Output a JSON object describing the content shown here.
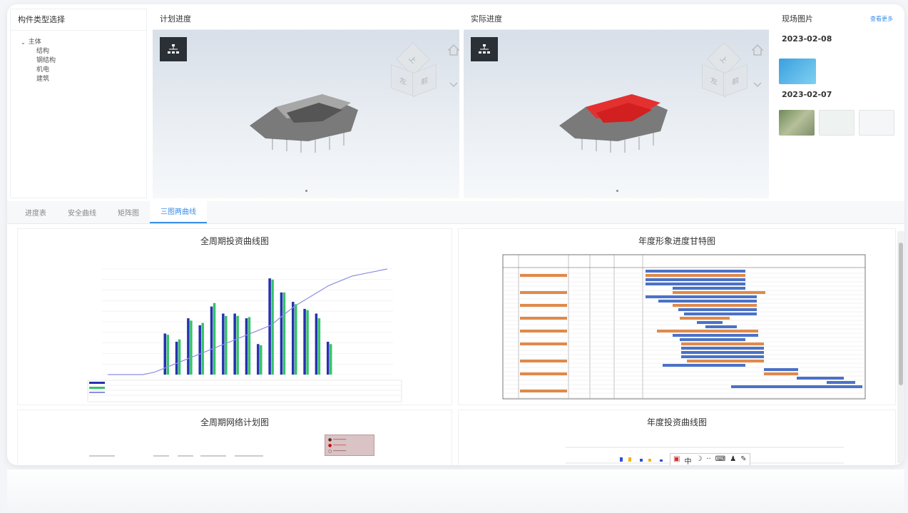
{
  "component_panel": {
    "title": "构件类型选择",
    "tree": {
      "root": "主体",
      "children": [
        "结构",
        "钢结构",
        "机电",
        "建筑"
      ]
    }
  },
  "plan_panel": {
    "title": "计划进度",
    "cube": {
      "top": "上",
      "left": "左",
      "front": "前"
    }
  },
  "actual_panel": {
    "title": "实际进度",
    "cube": {
      "top": "上",
      "left": "左",
      "front": "前"
    }
  },
  "photo_panel": {
    "title": "现场图片",
    "more_link": "查看更多",
    "groups": [
      {
        "date": "2023-02-08"
      },
      {
        "date": "2023-02-07"
      }
    ]
  },
  "tabs": [
    {
      "label": "进度表"
    },
    {
      "label": "安全曲线"
    },
    {
      "label": "矩阵图"
    },
    {
      "label": "三图两曲线",
      "active": true
    }
  ],
  "cards": {
    "investment_curve": {
      "title": "全周期投资曲线图"
    },
    "gantt": {
      "title": "年度形象进度甘特图"
    },
    "network": {
      "title": "全周期网络计划图"
    },
    "annual_investment": {
      "title": "年度投资曲线图"
    }
  },
  "chart_data": {
    "type": "bar",
    "title": "全周期投资曲线图",
    "series": [
      {
        "name": "series-blue",
        "values": [
          0,
          0,
          0,
          0,
          0,
          35,
          28,
          48,
          42,
          58,
          52,
          52,
          48,
          26,
          82,
          70,
          62,
          56,
          52,
          28,
          0,
          0,
          0,
          0,
          0
        ]
      },
      {
        "name": "series-green",
        "values": [
          0,
          0,
          0,
          0,
          0,
          34,
          30,
          46,
          44,
          61,
          50,
          50,
          49,
          25,
          81,
          70,
          60,
          55,
          48,
          26,
          0,
          0,
          0,
          0,
          0
        ]
      }
    ],
    "line": [
      0,
      0,
      0,
      0,
      2,
      6,
      10,
      14,
      18,
      22,
      26,
      30,
      34,
      38,
      42,
      50,
      58,
      64,
      70,
      76,
      80,
      84,
      86,
      88,
      90
    ],
    "ylim": [
      0,
      90
    ],
    "colors": {
      "blue": "#2531b0",
      "green": "#36c36a",
      "line": "#8b8fe0"
    }
  }
}
